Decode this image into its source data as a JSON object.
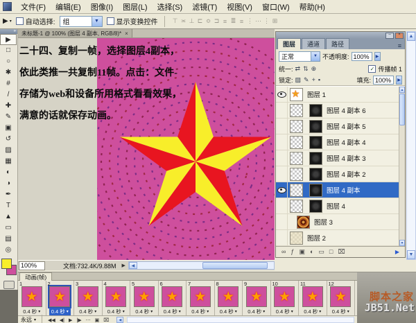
{
  "menu_bar": {
    "items": [
      {
        "label": "文件(F)"
      },
      {
        "label": "编辑(E)"
      },
      {
        "label": "图像(I)"
      },
      {
        "label": "图层(L)"
      },
      {
        "label": "选择(S)"
      },
      {
        "label": "滤镜(T)"
      },
      {
        "label": "视图(V)"
      },
      {
        "label": "窗口(W)"
      },
      {
        "label": "帮助(H)"
      }
    ]
  },
  "options_bar": {
    "auto_select_label": "自动选择:",
    "auto_select_value": "组",
    "show_transform_label": "显示变换控件",
    "align_icons": [
      {
        "g": "⊤"
      },
      {
        "g": "≍"
      },
      {
        "g": "⊥"
      },
      {
        "g": "⊏"
      },
      {
        "g": "≎"
      },
      {
        "g": "⊐"
      },
      {
        "g": "≡"
      },
      {
        "g": "≣"
      },
      {
        "g": "≡"
      },
      {
        "g": "⋮"
      },
      {
        "g": "⋯"
      },
      {
        "g": "⋮"
      },
      {
        "g": "⊞"
      }
    ]
  },
  "toolbox": {
    "tools": [
      {
        "name": "move-tool",
        "glyph": "▶",
        "active": true
      },
      {
        "name": "marquee-tool",
        "glyph": "□"
      },
      {
        "name": "lasso-tool",
        "glyph": "○"
      },
      {
        "name": "quick-selection-tool",
        "glyph": "✱"
      },
      {
        "name": "crop-tool",
        "glyph": "#"
      },
      {
        "name": "eyedropper-tool",
        "glyph": "/"
      },
      {
        "name": "healing-brush-tool",
        "glyph": "✚"
      },
      {
        "name": "brush-tool",
        "glyph": "✎"
      },
      {
        "name": "clone-stamp-tool",
        "glyph": "▣"
      },
      {
        "name": "history-brush-tool",
        "glyph": "↺"
      },
      {
        "name": "eraser-tool",
        "glyph": "▨"
      },
      {
        "name": "gradient-tool",
        "glyph": "▦"
      },
      {
        "name": "blur-tool",
        "glyph": "◐"
      },
      {
        "name": "dodge-tool",
        "glyph": "◑"
      },
      {
        "name": "pen-tool",
        "glyph": "✒"
      },
      {
        "name": "type-tool",
        "glyph": "T"
      },
      {
        "name": "path-select-tool",
        "glyph": "▲"
      },
      {
        "name": "shape-tool",
        "glyph": "▭"
      },
      {
        "name": "notes-tool",
        "glyph": "▤"
      },
      {
        "name": "zoom-tool",
        "glyph": "◎"
      }
    ],
    "foreground_color": "#f8ee2a",
    "background_color": "#ce4f9d"
  },
  "document_window": {
    "tab_title": "未标题-1 @ 100% (图层 4 副本, RGB/8)*",
    "status_zoom": "100%",
    "status_info": "文档:732.4K/9.88M",
    "annotation_lines": [
      {
        "text": "二十四、复制一帧，选择图层4副本，"
      },
      {
        "text": "依此类推一共复制11帧。点击：文件-"
      },
      {
        "text": "存储为web和设备所用格式看看效果，"
      },
      {
        "text": "满意的话就保存动画。"
      }
    ]
  },
  "colors": {
    "canvas_pink": "#ce4f9d",
    "star_red": "#e81520",
    "star_yellow": "#f8ee2a",
    "dash_purple": "#7c2d86",
    "dash_red": "#8f2350",
    "dash_crimson": "#a02844",
    "selection_blue": "#316ac5"
  },
  "layers_panel": {
    "tabs": [
      {
        "label": "图层",
        "active": true
      },
      {
        "label": "通道"
      },
      {
        "label": "路径"
      }
    ],
    "blend_mode": "正常",
    "opacity_label": "不透明度:",
    "opacity_value": "100%",
    "unify_label": "统一:",
    "unify_icons": [
      {
        "g": "⇄",
        "name": "unify-position-icon"
      },
      {
        "g": "⇅",
        "name": "unify-visibility-icon"
      },
      {
        "g": "⊕",
        "name": "unify-style-icon"
      }
    ],
    "propagate_label": "传播帧 1",
    "lock_label": "锁定:",
    "lock_icons": [
      {
        "g": "▨",
        "name": "lock-transparency-icon"
      },
      {
        "g": "✎",
        "name": "lock-pixels-icon"
      },
      {
        "g": "+",
        "name": "lock-position-icon"
      },
      {
        "g": "▪",
        "name": "lock-all-icon"
      }
    ],
    "fill_label": "填充:",
    "fill_value": "100%",
    "layers": [
      {
        "name": "图层 1",
        "visible": true,
        "selected": false,
        "thumb": "star"
      },
      {
        "name": "图层 4 副本 6",
        "visible": false,
        "selected": false,
        "thumb": "copy"
      },
      {
        "name": "图层 4 副本 5",
        "visible": false,
        "selected": false,
        "thumb": "copy"
      },
      {
        "name": "图层 4 副本 4",
        "visible": false,
        "selected": false,
        "thumb": "copy"
      },
      {
        "name": "图层 4 副本 3",
        "visible": false,
        "selected": false,
        "thumb": "copy"
      },
      {
        "name": "图层 4 副本 2",
        "visible": false,
        "selected": false,
        "thumb": "copy"
      },
      {
        "name": "图层 4 副本",
        "visible": true,
        "selected": true,
        "thumb": "copy"
      },
      {
        "name": "图层 4",
        "visible": false,
        "selected": false,
        "thumb": "copy"
      },
      {
        "name": "图层 3",
        "visible": false,
        "selected": false,
        "thumb": "circles"
      },
      {
        "name": "图层 2",
        "visible": false,
        "selected": false,
        "thumb": "cream"
      }
    ],
    "bottom_icons": [
      {
        "g": "∞",
        "name": "link-layers-icon"
      },
      {
        "g": "ƒ",
        "name": "layer-style-icon"
      },
      {
        "g": "▣",
        "name": "layer-mask-icon"
      },
      {
        "g": "◐",
        "name": "adjustment-layer-icon"
      },
      {
        "g": "▭",
        "name": "layer-group-icon"
      },
      {
        "g": "□",
        "name": "new-layer-icon"
      },
      {
        "g": "⌧",
        "name": "delete-layer-icon"
      }
    ]
  },
  "animation_panel": {
    "tab_label": "动画(帧)",
    "loop_label": "永远",
    "frames": [
      {
        "n": "1",
        "duration": "0.4 秒",
        "selected": false
      },
      {
        "n": "2",
        "duration": "0.4 秒",
        "selected": true
      },
      {
        "n": "3",
        "duration": "0.4 秒",
        "selected": false
      },
      {
        "n": "4",
        "duration": "0.4 秒",
        "selected": false
      },
      {
        "n": "5",
        "duration": "0.4 秒",
        "selected": false
      },
      {
        "n": "6",
        "duration": "0.4 秒",
        "selected": false
      },
      {
        "n": "7",
        "duration": "0.4 秒",
        "selected": false
      },
      {
        "n": "8",
        "duration": "0.4 秒",
        "selected": false
      },
      {
        "n": "9",
        "duration": "0.4 秒",
        "selected": false
      },
      {
        "n": "10",
        "duration": "0.4 秒",
        "selected": false
      },
      {
        "n": "11",
        "duration": "0.4 秒",
        "selected": false
      },
      {
        "n": "12",
        "duration": "0.4 秒",
        "selected": false
      }
    ],
    "controls": [
      {
        "g": "◀◀",
        "name": "first-frame-button"
      },
      {
        "g": "◀|",
        "name": "previous-frame-button"
      },
      {
        "g": "▶",
        "name": "play-button"
      },
      {
        "g": "|▶",
        "name": "next-frame-button"
      },
      {
        "g": "⋯",
        "name": "tween-button"
      },
      {
        "g": "▣",
        "name": "duplicate-frame-button"
      },
      {
        "g": "⌧",
        "name": "delete-frame-button"
      }
    ]
  },
  "watermark": {
    "site_name": "脚本之家",
    "site_url": "JB51.Net"
  },
  "icons": {
    "star": "★",
    "chevron_down": "▼",
    "chevron_small": "▾",
    "arrow_right": "▶",
    "arrow_left": "◀",
    "arrow_up": "▲",
    "panel_menu": "≡",
    "close": "×",
    "minimize": "–",
    "check": "✓"
  }
}
